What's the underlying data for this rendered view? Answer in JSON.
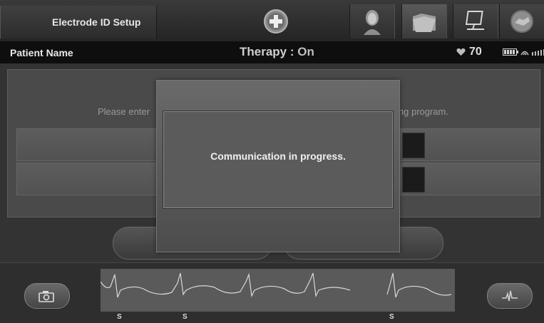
{
  "header": {
    "screen_title": "Electrode ID Setup",
    "icons": [
      "medical-cross-icon",
      "patient-icon",
      "folder-icon",
      "monitor-icon",
      "handshake-icon"
    ]
  },
  "patient_bar": {
    "patient_name": "Patient Name",
    "therapy_label": "Therapy : ",
    "therapy_value": "On",
    "heart_rate": "70"
  },
  "form": {
    "instruction_left": "Please enter",
    "instruction_right": "ing program."
  },
  "modal": {
    "message": "Communication in progress."
  },
  "ecg": {
    "beat_labels": [
      "S",
      "S",
      "S"
    ]
  },
  "colors": {
    "background": "#2a2a2a",
    "modal": "#5b5b5b",
    "ecg_strip": "#5a5a5a"
  }
}
